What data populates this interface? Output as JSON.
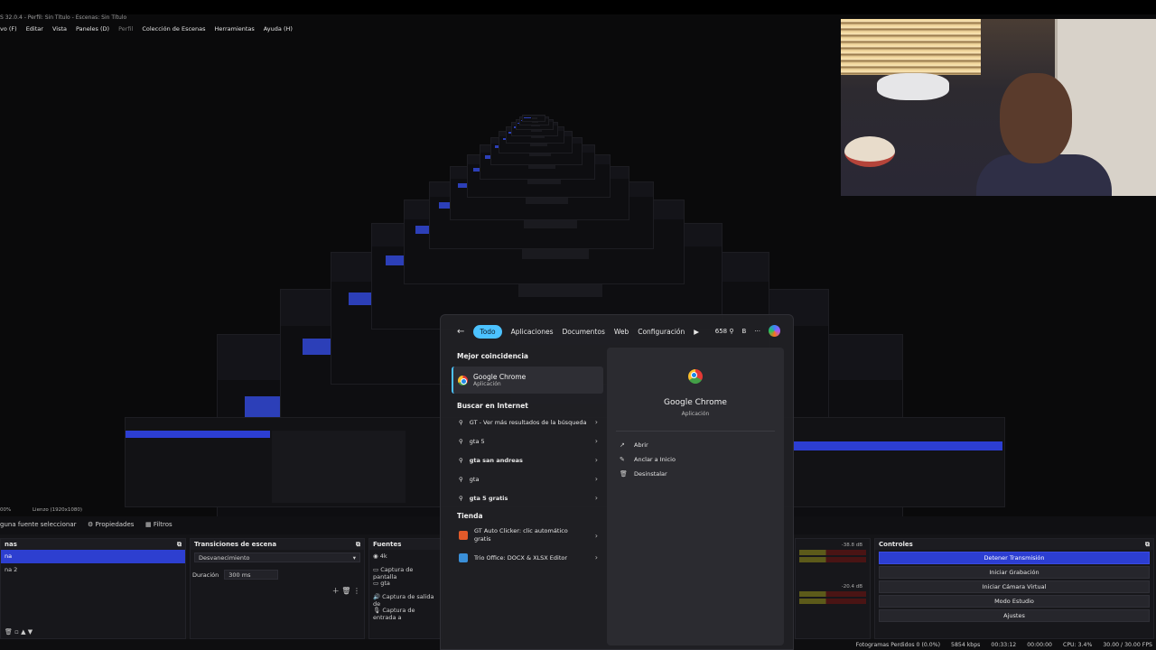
{
  "window": {
    "title": "S 32.0.4 - Perfil: Sin Título - Escenas: Sin Título",
    "menu": [
      "vo (F)",
      "Editar",
      "Vista",
      "Paneles (D)",
      "Perfil",
      "Colección de Escenas",
      "Herramientas",
      "Ayuda (H)"
    ]
  },
  "obs": {
    "canvas_label": "Lienzo (1920x1080)",
    "zoom": "00%",
    "no_source": "guna fuente seleccionar",
    "properties_tab": "Propiedades",
    "filters_tab": "Filtros",
    "scenes": {
      "title": "nas",
      "items": [
        "na",
        "na 2"
      ]
    },
    "transitions": {
      "title": "Transiciones de escena",
      "type": "Desvanecimiento",
      "duration_label": "Duración",
      "duration_value": "300 ms"
    },
    "sources": {
      "title": "Fuentes",
      "items": [
        "4k",
        "Captura de pantalla",
        "gta",
        "Captura de salida de",
        "Captura de entrada a"
      ]
    },
    "mixer": {
      "db1": "-38.8 dB",
      "db2": "-20.4 dB"
    },
    "controls": {
      "title": "Controles",
      "buttons": [
        "Detener Transmisión",
        "Iniciar Grabación",
        "Iniciar Cámara Virtual",
        "Modo Estudio",
        "Ajustes"
      ]
    },
    "status": {
      "dropped": "Fotogramas Perdidos 0 (0.0%)",
      "bitrate": "5854 kbps",
      "live_time": "00:33:12",
      "rec_time": "00:00:00",
      "cpu": "CPU: 3.4%",
      "fps": "30.00 / 30.00 FPS"
    }
  },
  "search": {
    "tabs": [
      "Todo",
      "Aplicaciones",
      "Documentos",
      "Web",
      "Configuración"
    ],
    "count": "658",
    "user_initial": "B",
    "more": "···",
    "best_match_header": "Mejor coincidencia",
    "best_match": {
      "name": "Google Chrome",
      "type": "Aplicación"
    },
    "internet_header": "Buscar en Internet",
    "internet": [
      "GT - Ver más resultados de la búsqueda",
      "gta 5",
      "gta san andreas",
      "gta",
      "gta 5 gratis"
    ],
    "store_header": "Tienda",
    "store": [
      {
        "name": "GT Auto Clicker: clic automático gratis",
        "color": "#e25a2a"
      },
      {
        "name": "Trio Office: DOCX & XLSX Editor",
        "color": "#3a8fd8"
      }
    ],
    "detail": {
      "name": "Google Chrome",
      "type": "Aplicación",
      "actions": [
        "Abrir",
        "Anclar a Inicio",
        "Desinstalar"
      ]
    }
  },
  "colors": {
    "accent": "#4cc2ff",
    "obs_blue": "#2c3ed2"
  }
}
